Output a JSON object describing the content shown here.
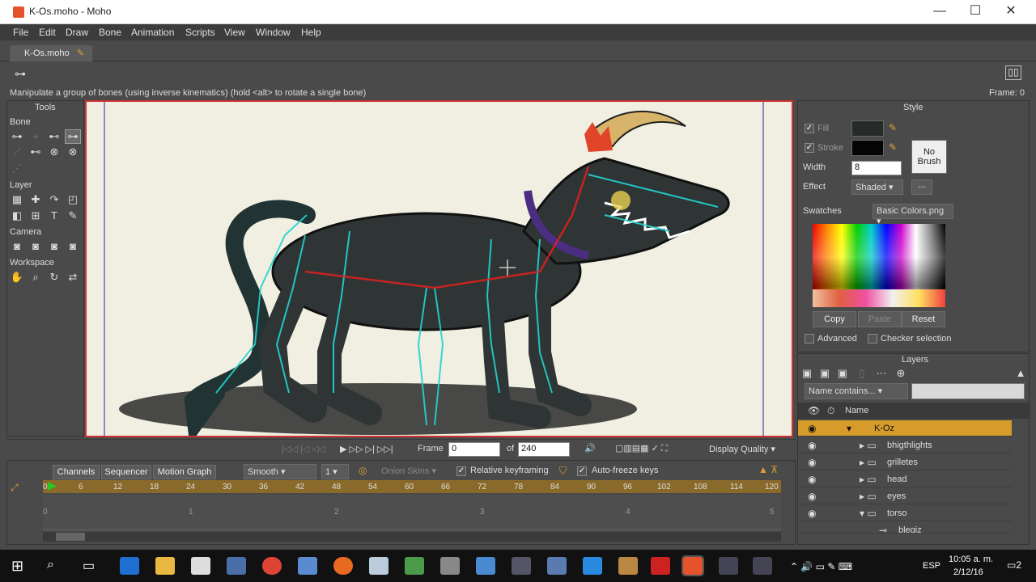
{
  "window": {
    "title": "K-Os.moho - Moho",
    "minimize": "—",
    "maximize": "☐",
    "close": "✕"
  },
  "menu": [
    "File",
    "Edit",
    "Draw",
    "Bone",
    "Animation",
    "Scripts",
    "View",
    "Window",
    "Help"
  ],
  "doc_tab": {
    "label": "K-Os.moho",
    "edit_icon": "pencil-icon"
  },
  "status": {
    "message": "Manipulate a group of bones (using inverse kinematics) (hold <alt> to rotate a single bone)",
    "frame": "Frame: 0"
  },
  "tools": {
    "title": "Tools",
    "sections": {
      "bone": "Bone",
      "layer": "Layer",
      "camera": "Camera",
      "workspace": "Workspace"
    }
  },
  "style": {
    "title": "Style",
    "fill_label": "Fill",
    "stroke_label": "Stroke",
    "width_label": "Width",
    "width_value": "8",
    "no_brush": "No Brush",
    "effect_label": "Effect",
    "effect_value": "Shaded",
    "effect_more": "...",
    "swatches_label": "Swatches",
    "swatches_value": "Basic Colors.png",
    "copy": "Copy",
    "paste": "Paste",
    "reset": "Reset",
    "advanced": "Advanced",
    "checker": "Checker selection"
  },
  "layers": {
    "title": "Layers",
    "filter_value": "Name contains...",
    "name_header": "Name",
    "rows": [
      {
        "name": "K-Oz",
        "selected": true
      },
      {
        "name": "bhigthlights",
        "selected": false
      },
      {
        "name": "grilletes",
        "selected": false
      },
      {
        "name": "head",
        "selected": false
      },
      {
        "name": "eyes",
        "selected": false
      },
      {
        "name": "torso",
        "selected": false
      },
      {
        "name": "blegiz",
        "selected": false
      }
    ]
  },
  "playback": {
    "frame_label": "Frame",
    "frame_value": "0",
    "of_label": "of",
    "total": "240",
    "display_quality": "Display Quality"
  },
  "timeline": {
    "tabs": [
      "Channels",
      "Sequencer",
      "Motion Graph"
    ],
    "interpolation": "Smooth",
    "interp_value": "1",
    "onion": "Onion Skins",
    "relative": "Relative keyframing",
    "autofreeze": "Auto-freeze keys",
    "ruler": [
      "0",
      "6",
      "12",
      "18",
      "24",
      "30",
      "36",
      "42",
      "48",
      "54",
      "60",
      "66",
      "72",
      "78",
      "84",
      "90",
      "96",
      "102",
      "108",
      "114",
      "120"
    ],
    "seconds": [
      "0",
      "1",
      "2",
      "3",
      "4",
      "5"
    ]
  },
  "taskbar": {
    "time": "10:05 a. m.",
    "date": "2/12/16",
    "lang": "ESP",
    "notifications": "2"
  },
  "colors": {
    "accent": "#d69b2a",
    "canvas_border": "#cc3333",
    "panel": "#4a4a4a"
  }
}
